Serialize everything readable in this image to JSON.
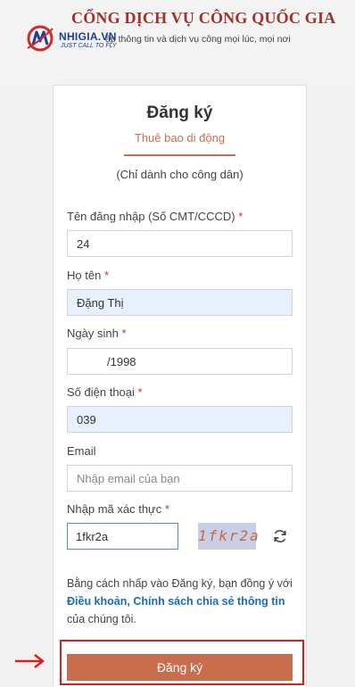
{
  "header": {
    "portal_title": "CỔNG DỊCH VỤ CÔNG QUỐC GIA",
    "portal_subtitle": "ập thông tin và dịch vụ công mọi lúc, mọi nơi",
    "logo_brand": "NHIGIA.VN",
    "logo_tagline": "JUST CALL TO FLY",
    "logo_icon": "nhigia-logo-icon"
  },
  "form": {
    "title": "Đăng ký",
    "tab_label": "Thuê bao di động",
    "note": "(Chỉ dành cho công dân)",
    "fields": {
      "username": {
        "label": "Tên đăng nhập (Số CMT/CCCD)",
        "value": "24"
      },
      "fullname": {
        "label": "Họ tên",
        "value": "Đặng Thị"
      },
      "birthdate": {
        "label": "Ngày sinh",
        "value": "/1998"
      },
      "phone": {
        "label": "Số điện thoại",
        "value": "039"
      },
      "email": {
        "label": "Email",
        "value": "",
        "placeholder": "Nhập email của bạn"
      },
      "captcha": {
        "label": "Nhập mã xác thực",
        "value": "1fkr2a",
        "image_text": "1fkr2a"
      }
    },
    "required_mark": "*",
    "terms": {
      "prefix": "Bằng cách nhấp vào Đăng ký, bạn đồng ý với ",
      "link": "Điều khoản, Chính sách chia sẻ thông tin",
      "suffix": " của chúng tôi."
    },
    "submit_label": "Đăng ký"
  },
  "colors": {
    "accent": "#c96d4f",
    "title_red": "#a0322c",
    "link_blue": "#1a6db3",
    "highlight_red": "#e11a1a",
    "autofill_blue": "#e8f0fe"
  },
  "icons": {
    "refresh": "refresh-icon",
    "arrow": "arrow-right-icon"
  }
}
